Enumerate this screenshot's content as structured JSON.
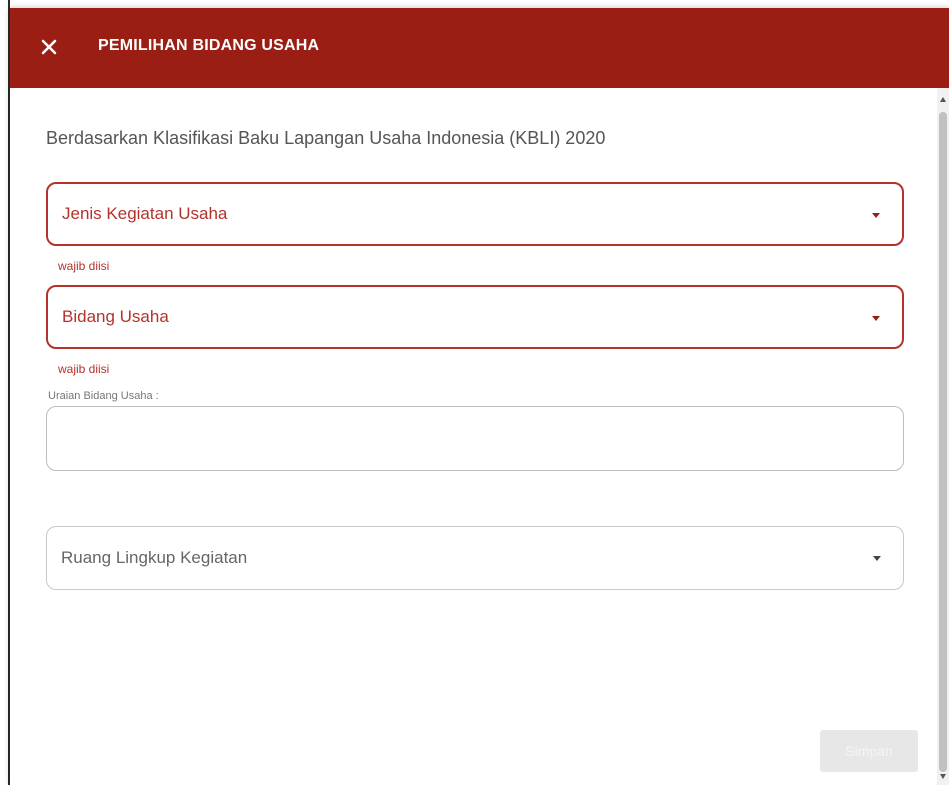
{
  "header": {
    "title": "PEMILIHAN BIDANG USAHA",
    "close_icon": "close-icon",
    "background_color": "#9b1e14"
  },
  "form": {
    "subtitle": "Berdasarkan Klasifikasi Baku Lapangan Usaha Indonesia (KBLI) 2020",
    "jenis_kegiatan": {
      "label": "Jenis Kegiatan Usaha",
      "helper": "wajib diisi",
      "state": "error"
    },
    "bidang_usaha": {
      "label": "Bidang Usaha",
      "helper": "wajib diisi",
      "state": "error"
    },
    "uraian": {
      "label": "Uraian Bidang Usaha :",
      "value": ""
    },
    "ruang_lingkup": {
      "label": "Ruang Lingkup Kegiatan",
      "state": "normal"
    },
    "error_color": "#b3332b"
  },
  "footer": {
    "save_label": "Simpan",
    "save_disabled": true
  }
}
